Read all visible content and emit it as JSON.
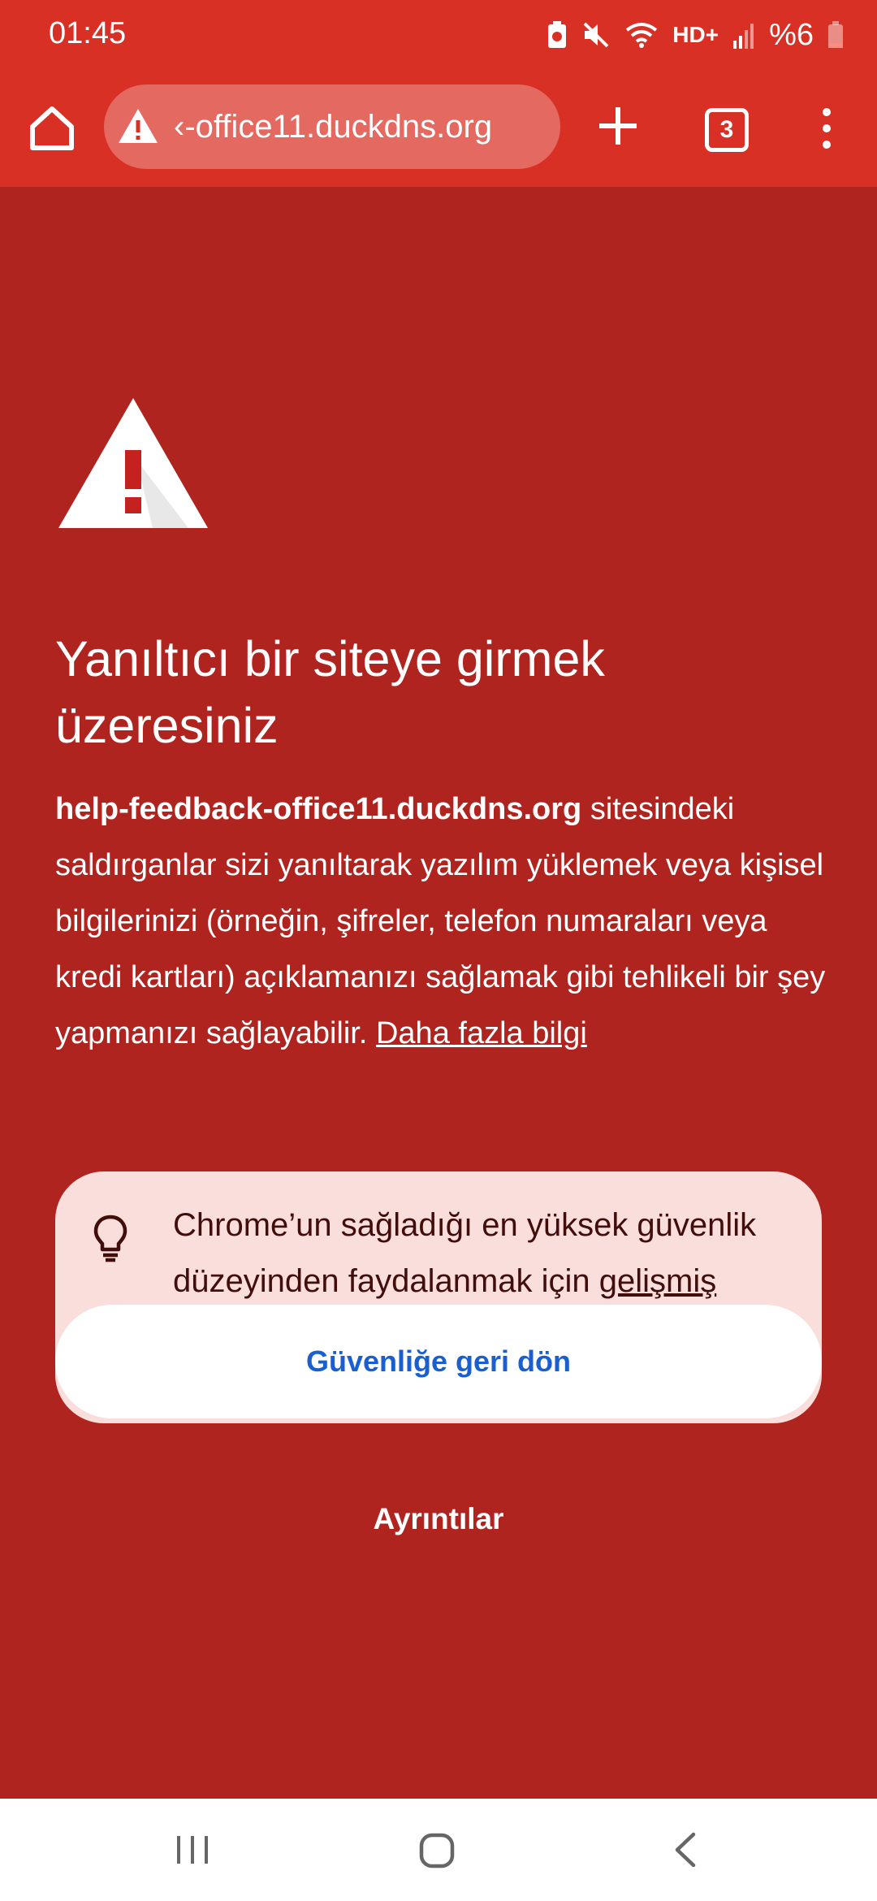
{
  "status_bar": {
    "time": "01:45",
    "network": "HD+",
    "battery": "%6"
  },
  "toolbar": {
    "url": "‹-office11.duckdns.org",
    "tab_count": "3"
  },
  "warning": {
    "title": "Yanıltıcı bir siteye girmek üzeresiniz",
    "site": "help-feedback-office11.duckdns.org",
    "description": " sitesindeki saldırganlar sizi yanıltarak yazılım yüklemek veya kişisel bilgilerinizi (örneğin, şifreler, telefon numaraları veya kredi kartları) açıklamanızı sağlamak gibi tehlikeli bir şey yapmanızı sağlayabilir. ",
    "learn_more": "Daha fazla bilgi"
  },
  "tip": {
    "text": "Chrome’un sağladığı en yüksek güvenlik düzeyinden faydalanmak için ",
    "link": "gelişmiş korumayı açın"
  },
  "actions": {
    "back_to_safety": "Güvenliğe geri dön",
    "details": "Ayrıntılar"
  },
  "colors": {
    "toolbar": "#d93025",
    "page_background": "#b0241f",
    "tip_background": "#f9dedc",
    "button_text": "#1a5fd0"
  }
}
